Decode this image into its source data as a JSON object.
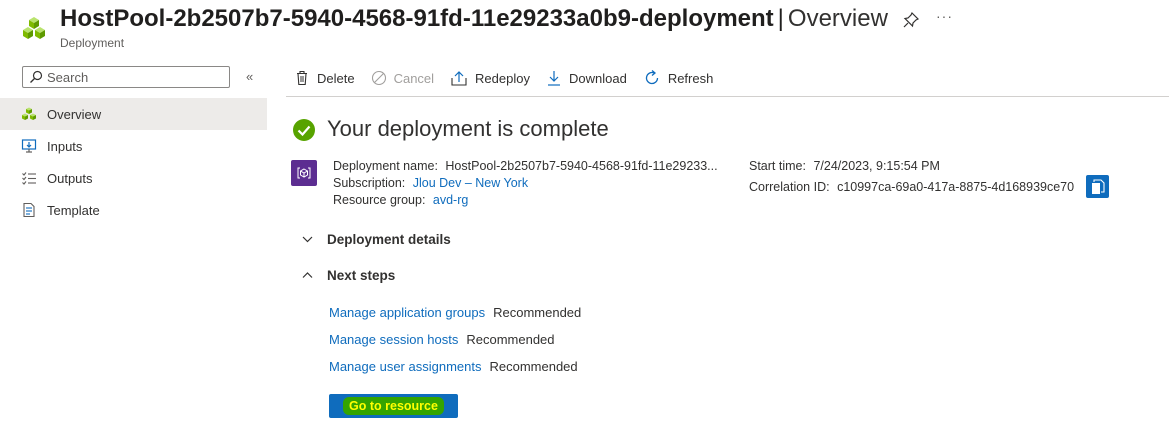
{
  "header": {
    "title_main": "HostPool-2b2507b7-5940-4568-91fd-11e29233a0b9-deployment",
    "separator": "|",
    "title_view": "Overview",
    "subtitle": "Deployment",
    "more": "···",
    "icon": "deployment-cubes-icon"
  },
  "sidebar": {
    "search_placeholder": "Search",
    "collapse": "«",
    "items": [
      {
        "label": "Overview",
        "icon": "overview-icon",
        "active": true
      },
      {
        "label": "Inputs",
        "icon": "inputs-icon"
      },
      {
        "label": "Outputs",
        "icon": "outputs-icon"
      },
      {
        "label": "Template",
        "icon": "template-icon"
      }
    ]
  },
  "toolbar": {
    "delete": "Delete",
    "cancel": "Cancel",
    "redeploy": "Redeploy",
    "download": "Download",
    "refresh": "Refresh"
  },
  "main": {
    "status": "Your deployment is complete",
    "details": {
      "deployment_name_label": "Deployment name:",
      "deployment_name": "HostPool-2b2507b7-5940-4568-91fd-11e29233...",
      "subscription_label": "Subscription:",
      "subscription": "Jlou Dev – New York",
      "resource_group_label": "Resource group:",
      "resource_group": "avd-rg",
      "start_time_label": "Start time:",
      "start_time": "7/24/2023, 9:15:54 PM",
      "correlation_label": "Correlation ID:",
      "correlation_id": "c10997ca-69a0-417a-8875-4d168939ce70"
    },
    "deployment_details": "Deployment details",
    "next_steps": "Next steps",
    "steps": [
      {
        "link": "Manage application groups",
        "tag": "Recommended"
      },
      {
        "link": "Manage session hosts",
        "tag": "Recommended"
      },
      {
        "link": "Manage user assignments",
        "tag": "Recommended"
      }
    ],
    "go_button": "Go to resource"
  },
  "colors": {
    "accent": "#0f6cbd",
    "success": "#57a300",
    "resource_icon": "#5c2d91",
    "highlight_bg": "#34a400",
    "highlight_text": "#ffff00"
  }
}
